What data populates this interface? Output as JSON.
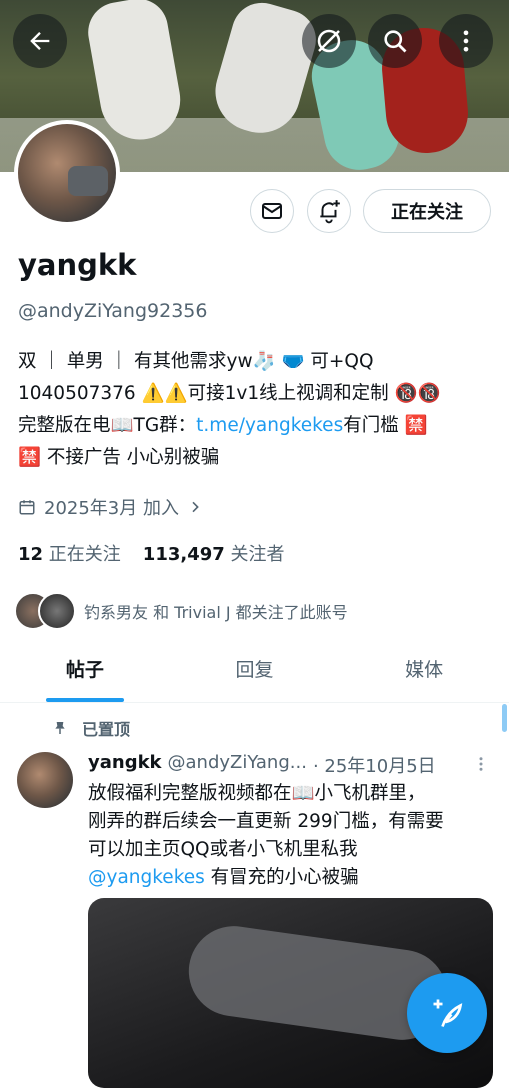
{
  "profile": {
    "name": "yangkk",
    "handle": "@andyZiYang92356",
    "bio_line1": "双 ｜ 单男 ｜ 有其他需求yw🧦 🩲 可+QQ",
    "bio_line2": "1040507376 ⚠️⚠️可接1v1线上视调和定制 🔞🔞",
    "bio_line3_prefix": "完整版在电📖TG群：",
    "bio_link": "t.me/yangkekes",
    "bio_line3_suffix": "有门槛 🈲",
    "bio_line4": "🈲 不接广告 小心别被骗",
    "joined": "2025年3月 加入",
    "following_count": "12",
    "following_label": "正在关注",
    "followers_count": "113,497",
    "followers_label": "关注者",
    "followed_by": "钓系男友 和 Trivial J 都关注了此账号",
    "follow_button": "正在关注"
  },
  "icons": {
    "back": "back-arrow-icon",
    "grok": "slash-circle-icon",
    "search": "search-icon",
    "more": "more-vertical-icon",
    "message": "mail-icon",
    "notify": "bell-plus-icon",
    "calendar": "calendar-icon",
    "pin": "pin-icon",
    "compose": "feather-plus-icon"
  },
  "tabs": [
    {
      "label": "帖子"
    },
    {
      "label": "回复"
    },
    {
      "label": "媒体"
    }
  ],
  "post": {
    "pinned_label": "已置顶",
    "author": "yangkk",
    "author_handle": "@andyZiYang...",
    "date": "· 25年10月5日",
    "text_line1": "放假福利完整版视频都在📖小飞机群里，",
    "text_line2": "刚弄的群后续会一直更新 299门槛，有需要",
    "text_line3": "可以加主页QQ或者小飞机里私我",
    "mention": "@yangkekes",
    "text_line4_suffix": " 有冒充的小心被骗"
  },
  "colors": {
    "accent": "#1d9bf0",
    "text": "#0f1419",
    "secondary": "#536471"
  }
}
